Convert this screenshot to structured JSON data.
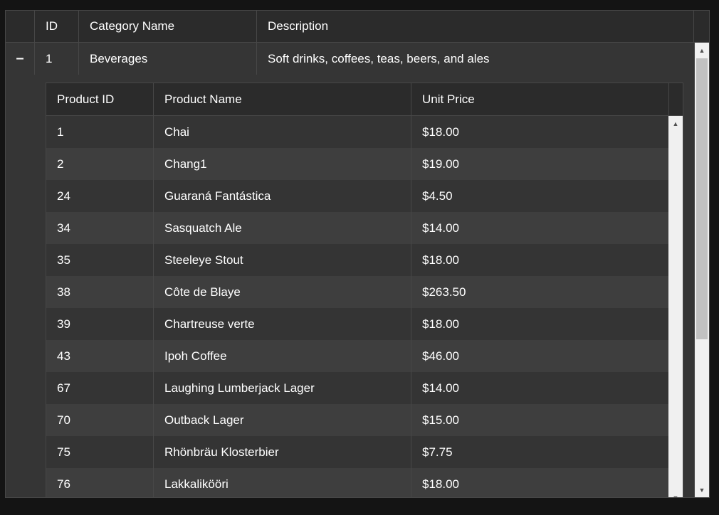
{
  "master": {
    "columns": [
      "ID",
      "Category Name",
      "Description"
    ],
    "row": {
      "expander": "–",
      "id": "1",
      "category_name": "Beverages",
      "description": "Soft drinks, coffees, teas, beers, and ales"
    }
  },
  "detail": {
    "columns": [
      "Product ID",
      "Product Name",
      "Unit Price"
    ],
    "rows": [
      {
        "id": "1",
        "name": "Chai",
        "price": "$18.00"
      },
      {
        "id": "2",
        "name": "Chang1",
        "price": "$19.00"
      },
      {
        "id": "24",
        "name": "Guaraná Fantástica",
        "price": "$4.50"
      },
      {
        "id": "34",
        "name": "Sasquatch Ale",
        "price": "$14.00"
      },
      {
        "id": "35",
        "name": "Steeleye Stout",
        "price": "$18.00"
      },
      {
        "id": "38",
        "name": "Côte de Blaye",
        "price": "$263.50"
      },
      {
        "id": "39",
        "name": "Chartreuse verte",
        "price": "$18.00"
      },
      {
        "id": "43",
        "name": "Ipoh Coffee",
        "price": "$46.00"
      },
      {
        "id": "67",
        "name": "Laughing Lumberjack Lager",
        "price": "$14.00"
      },
      {
        "id": "70",
        "name": "Outback Lager",
        "price": "$15.00"
      },
      {
        "id": "75",
        "name": "Rhönbräu Klosterbier",
        "price": "$7.75"
      },
      {
        "id": "76",
        "name": "Lakkalikööri",
        "price": "$18.00"
      }
    ]
  },
  "icons": {
    "scroll_up": "scroll-up-arrow-icon",
    "scroll_down": "scroll-down-arrow-icon"
  }
}
